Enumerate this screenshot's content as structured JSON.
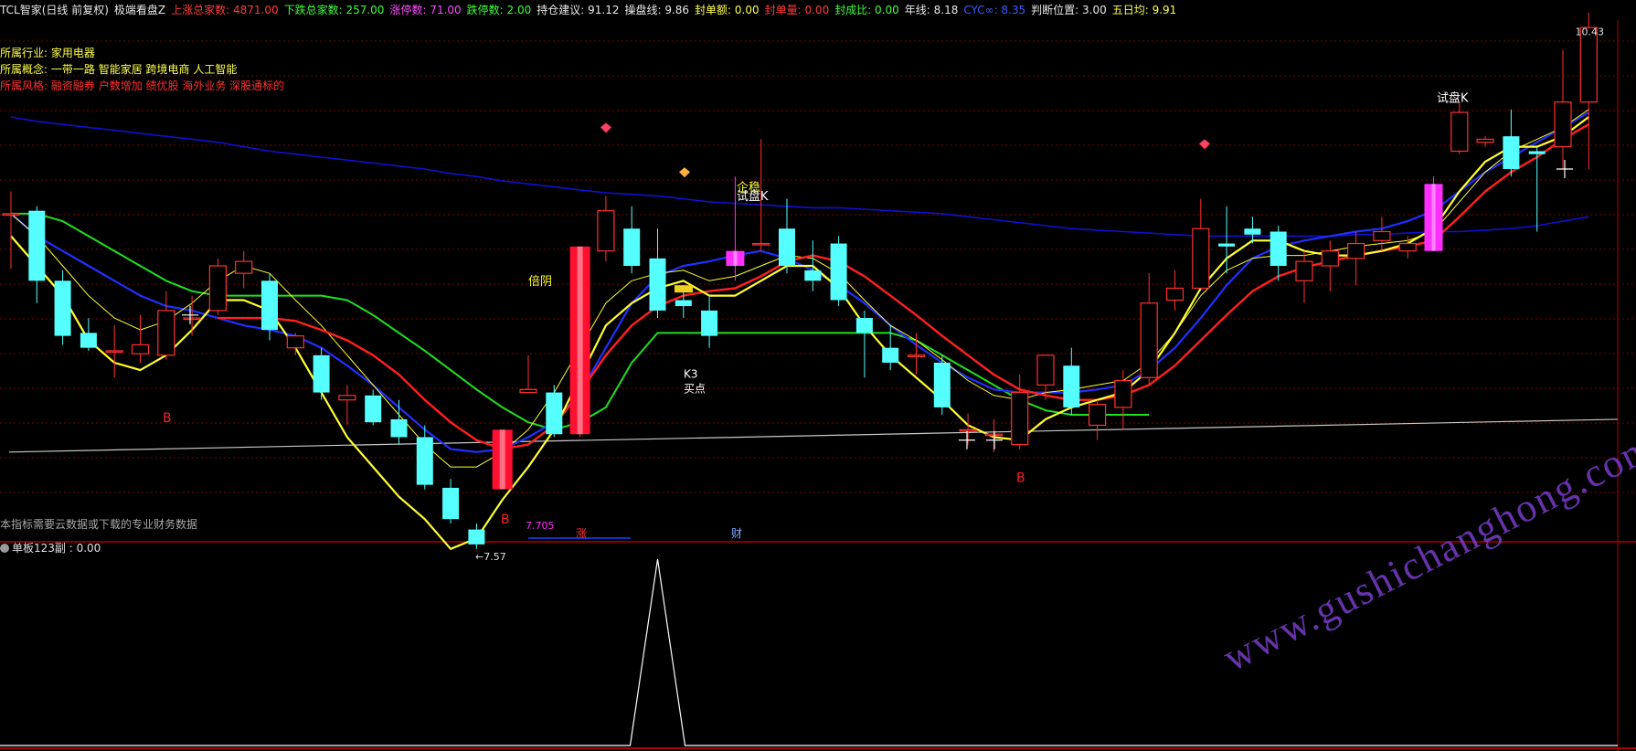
{
  "header": {
    "items": [
      {
        "label": "TCL智家(日线 前复权)",
        "color": "#e8e8e8"
      },
      {
        "label": "极端看盘Z",
        "color": "#e8e8e8"
      },
      {
        "label": "上涨总家数: 4871.00",
        "color": "#ff3b3b"
      },
      {
        "label": "下跌总家数: 257.00",
        "color": "#3cff3c"
      },
      {
        "label": "涨停数: 71.00",
        "color": "#ff4dff"
      },
      {
        "label": "跌停数: 2.00",
        "color": "#3cff3c"
      },
      {
        "label": "持仓建议: 91.12",
        "color": "#e8e8e8"
      },
      {
        "label": "操盘线: 9.86",
        "color": "#e8e8e8"
      },
      {
        "label": "封单额: 0.00",
        "color": "#ffff4d"
      },
      {
        "label": "封单量: 0.00",
        "color": "#ff3b3b"
      },
      {
        "label": "封成比: 0.00",
        "color": "#3cff3c"
      },
      {
        "label": "年线: 8.18",
        "color": "#e8e8e8"
      },
      {
        "label": "CYC∞: 8.35",
        "color": "#3c5cff"
      },
      {
        "label": "判断位置: 3.00",
        "color": "#e8e8e8"
      },
      {
        "label": "五日均: 9.91",
        "color": "#ffff4d"
      }
    ]
  },
  "info": {
    "industry_label": "所属行业:",
    "industry_value": "家用电器",
    "concept_label": "所属概念:",
    "concept_value": "一带一路 智能家居 跨境电商 人工智能",
    "style_label": "所属风格:",
    "style_value": "融资融券 户数增加 绩优股 海外业务 深股通标的"
  },
  "note": "本指标需要云数据或下载的专业财务数据",
  "sub_panel": {
    "title": "单板123副 : 0.00"
  },
  "watermark": "www.gushichanghong.com",
  "colors": {
    "up": "#ff3030",
    "down": "#55ffff",
    "ma_yellow": "#ffff30",
    "ma_red": "#ff2020",
    "ma_blue": "#2030ff",
    "ma_green": "#20e020",
    "cyc_blue": "#1010d0",
    "year_line": "#c8c8c8",
    "magenta": "#ff30ff",
    "grid": "#800000"
  },
  "chart_data": {
    "type": "candlestick",
    "price_range": [
      7.3,
      10.6
    ],
    "candles": [
      {
        "o": 9.3,
        "h": 9.45,
        "l": 8.93,
        "c": 9.3
      },
      {
        "o": 9.32,
        "h": 9.35,
        "l": 8.7,
        "c": 8.85
      },
      {
        "o": 8.85,
        "h": 8.92,
        "l": 8.42,
        "c": 8.48
      },
      {
        "o": 8.5,
        "h": 8.6,
        "l": 8.38,
        "c": 8.4
      },
      {
        "o": 8.38,
        "h": 8.55,
        "l": 8.2,
        "c": 8.38
      },
      {
        "o": 8.36,
        "h": 8.62,
        "l": 8.3,
        "c": 8.42
      },
      {
        "o": 8.35,
        "h": 8.78,
        "l": 8.32,
        "c": 8.65
      },
      {
        "o": 8.6,
        "h": 8.75,
        "l": 8.48,
        "c": 8.6
      },
      {
        "o": 8.65,
        "h": 9.0,
        "l": 8.62,
        "c": 8.95
      },
      {
        "o": 8.9,
        "h": 9.05,
        "l": 8.8,
        "c": 8.98
      },
      {
        "o": 8.85,
        "h": 8.9,
        "l": 8.45,
        "c": 8.52
      },
      {
        "o": 8.4,
        "h": 8.5,
        "l": 8.35,
        "c": 8.48
      },
      {
        "o": 8.35,
        "h": 8.4,
        "l": 8.05,
        "c": 8.1
      },
      {
        "o": 8.05,
        "h": 8.15,
        "l": 7.88,
        "c": 8.08
      },
      {
        "o": 8.08,
        "h": 8.12,
        "l": 7.88,
        "c": 7.9
      },
      {
        "o": 7.92,
        "h": 8.05,
        "l": 7.75,
        "c": 7.8
      },
      {
        "o": 7.8,
        "h": 7.88,
        "l": 7.45,
        "c": 7.48
      },
      {
        "o": 7.46,
        "h": 7.52,
        "l": 7.22,
        "c": 7.25
      },
      {
        "o": 7.18,
        "h": 7.22,
        "l": 7.05,
        "c": 7.08
      },
      {
        "o": 7.45,
        "h": 7.85,
        "l": 7.45,
        "c": 7.85
      },
      {
        "o": 8.1,
        "h": 8.35,
        "l": 8.1,
        "c": 8.12
      },
      {
        "o": 8.1,
        "h": 8.15,
        "l": 7.8,
        "c": 7.82
      },
      {
        "o": 7.82,
        "h": 9.08,
        "l": 7.8,
        "c": 9.08
      },
      {
        "o": 9.05,
        "h": 9.42,
        "l": 8.98,
        "c": 9.32
      },
      {
        "o": 9.2,
        "h": 9.35,
        "l": 8.9,
        "c": 8.95
      },
      {
        "o": 9.0,
        "h": 9.2,
        "l": 8.6,
        "c": 8.65
      },
      {
        "o": 8.72,
        "h": 8.82,
        "l": 8.6,
        "c": 8.68
      },
      {
        "o": 8.65,
        "h": 8.75,
        "l": 8.4,
        "c": 8.48
      },
      {
        "o": 9.05,
        "h": 9.55,
        "l": 8.85,
        "c": 8.95
      },
      {
        "o": 9.1,
        "h": 9.8,
        "l": 9.05,
        "c": 9.1
      },
      {
        "o": 9.2,
        "h": 9.4,
        "l": 8.9,
        "c": 8.95
      },
      {
        "o": 8.92,
        "h": 9.12,
        "l": 8.78,
        "c": 8.85
      },
      {
        "o": 9.1,
        "h": 9.15,
        "l": 8.68,
        "c": 8.72
      },
      {
        "o": 8.6,
        "h": 8.65,
        "l": 8.2,
        "c": 8.5
      },
      {
        "o": 8.4,
        "h": 8.55,
        "l": 8.25,
        "c": 8.3
      },
      {
        "o": 8.35,
        "h": 8.5,
        "l": 8.22,
        "c": 8.35
      },
      {
        "o": 8.3,
        "h": 8.35,
        "l": 7.95,
        "c": 8.0
      },
      {
        "o": 7.85,
        "h": 7.96,
        "l": 7.75,
        "c": 7.85
      },
      {
        "o": 7.82,
        "h": 7.92,
        "l": 7.7,
        "c": 7.82
      },
      {
        "o": 7.75,
        "h": 8.22,
        "l": 7.72,
        "c": 8.1
      },
      {
        "o": 8.15,
        "h": 8.35,
        "l": 8.05,
        "c": 8.35
      },
      {
        "o": 8.28,
        "h": 8.4,
        "l": 7.95,
        "c": 8.0
      },
      {
        "o": 7.88,
        "h": 8.05,
        "l": 7.78,
        "c": 8.02
      },
      {
        "o": 8.0,
        "h": 8.25,
        "l": 7.85,
        "c": 8.18
      },
      {
        "o": 8.2,
        "h": 8.9,
        "l": 8.15,
        "c": 8.7
      },
      {
        "o": 8.72,
        "h": 8.92,
        "l": 8.65,
        "c": 8.8
      },
      {
        "o": 8.8,
        "h": 9.4,
        "l": 8.8,
        "c": 9.2
      },
      {
        "o": 9.1,
        "h": 9.35,
        "l": 8.9,
        "c": 9.08
      },
      {
        "o": 9.2,
        "h": 9.28,
        "l": 9.1,
        "c": 9.16
      },
      {
        "o": 9.18,
        "h": 9.22,
        "l": 8.85,
        "c": 8.95
      },
      {
        "o": 8.85,
        "h": 9.05,
        "l": 8.7,
        "c": 8.98
      },
      {
        "o": 8.95,
        "h": 9.12,
        "l": 8.78,
        "c": 9.05
      },
      {
        "o": 9.0,
        "h": 9.18,
        "l": 8.82,
        "c": 9.1
      },
      {
        "o": 9.12,
        "h": 9.28,
        "l": 9.05,
        "c": 9.18
      },
      {
        "o": 9.05,
        "h": 9.15,
        "l": 9.0,
        "c": 9.1
      },
      {
        "o": 9.5,
        "h": 9.55,
        "l": 9.05,
        "c": 9.05
      },
      {
        "o": 9.72,
        "h": 10.05,
        "l": 9.7,
        "c": 9.98
      },
      {
        "o": 9.78,
        "h": 9.82,
        "l": 9.75,
        "c": 9.8
      },
      {
        "o": 9.82,
        "h": 10.0,
        "l": 9.55,
        "c": 9.6
      },
      {
        "o": 9.72,
        "h": 9.75,
        "l": 9.18,
        "c": 9.7
      },
      {
        "o": 9.75,
        "h": 10.4,
        "l": 9.6,
        "c": 10.05
      },
      {
        "o": 10.05,
        "h": 10.65,
        "l": 9.6,
        "c": 10.55
      }
    ],
    "line_yellow": [
      9.15,
      8.95,
      8.75,
      8.45,
      8.3,
      8.25,
      8.35,
      8.52,
      8.72,
      8.72,
      8.65,
      8.4,
      8.1,
      7.8,
      7.6,
      7.4,
      7.25,
      7.05,
      7.12,
      7.38,
      7.6,
      7.85,
      8.2,
      8.55,
      8.7,
      8.8,
      8.85,
      8.75,
      8.75,
      8.85,
      8.95,
      8.95,
      8.8,
      8.55,
      8.35,
      8.2,
      8.05,
      7.88,
      7.8,
      7.78,
      7.92,
      8.0,
      8.05,
      8.1,
      8.25,
      8.5,
      8.8,
      9.0,
      9.12,
      9.12,
      9.05,
      9.02,
      9.02,
      9.05,
      9.1,
      9.2,
      9.45,
      9.65,
      9.75,
      9.75,
      9.82,
      9.95
    ],
    "line_thin_yellow": [
      9.3,
      9.15,
      8.95,
      8.75,
      8.6,
      8.52,
      8.58,
      8.7,
      8.85,
      8.95,
      8.9,
      8.72,
      8.55,
      8.35,
      8.15,
      7.95,
      7.75,
      7.6,
      7.6,
      7.7,
      7.85,
      8.1,
      8.4,
      8.7,
      8.85,
      8.9,
      8.92,
      8.85,
      8.88,
      8.95,
      9.02,
      9.0,
      8.9,
      8.72,
      8.55,
      8.45,
      8.32,
      8.18,
      8.08,
      8.05,
      8.1,
      8.12,
      8.15,
      8.18,
      8.3,
      8.5,
      8.75,
      8.92,
      9.0,
      9.02,
      9.02,
      9.05,
      9.08,
      9.1,
      9.12,
      9.18,
      9.38,
      9.58,
      9.72,
      9.8,
      9.88,
      10.0
    ],
    "line_red": [
      null,
      null,
      null,
      null,
      null,
      null,
      null,
      null,
      8.6,
      8.6,
      8.6,
      8.58,
      8.52,
      8.45,
      8.35,
      8.22,
      8.05,
      7.9,
      7.78,
      7.72,
      7.75,
      7.88,
      8.1,
      8.35,
      8.55,
      8.68,
      8.75,
      8.78,
      8.8,
      8.88,
      8.98,
      9.02,
      8.98,
      8.88,
      8.75,
      8.62,
      8.48,
      8.35,
      8.22,
      8.12,
      8.08,
      8.05,
      8.05,
      8.08,
      8.15,
      8.28,
      8.45,
      8.62,
      8.78,
      8.88,
      8.94,
      8.98,
      9.02,
      9.05,
      9.08,
      9.12,
      9.28,
      9.45,
      9.58,
      9.68,
      9.8,
      9.9
    ],
    "line_blue": [
      9.3,
      9.15,
      9.05,
      8.95,
      8.85,
      8.75,
      8.68,
      8.65,
      8.6,
      8.55,
      8.52,
      8.48,
      8.4,
      8.28,
      8.15,
      8.0,
      7.85,
      7.72,
      7.7,
      7.72,
      7.8,
      7.9,
      8.1,
      8.4,
      8.7,
      8.88,
      8.95,
      8.98,
      9.02,
      9.05,
      9.0,
      8.92,
      8.82,
      8.7,
      8.55,
      8.42,
      8.3,
      8.2,
      8.12,
      8.1,
      8.1,
      8.1,
      8.12,
      8.15,
      8.25,
      8.4,
      8.6,
      8.82,
      9.0,
      9.08,
      9.12,
      9.15,
      9.18,
      9.2,
      9.25,
      9.32,
      9.45,
      9.58,
      9.68,
      9.78,
      9.88,
      9.98
    ],
    "line_green": [
      9.3,
      9.3,
      9.25,
      9.15,
      9.05,
      8.95,
      8.85,
      8.78,
      8.75,
      8.75,
      8.75,
      8.75,
      8.75,
      8.72,
      8.62,
      8.5,
      8.38,
      8.25,
      8.12,
      8.0,
      7.9,
      7.85,
      7.9,
      8.0,
      8.3,
      8.5,
      8.5,
      8.5,
      8.5,
      8.5,
      8.5,
      8.5,
      8.5,
      8.5,
      8.5,
      8.45,
      8.35,
      8.25,
      8.15,
      8.05,
      7.98,
      7.95,
      7.95,
      7.95,
      7.95
    ],
    "cyc_blue": [
      9.95,
      9.92,
      9.9,
      9.88,
      9.86,
      9.84,
      9.82,
      9.8,
      9.78,
      9.75,
      9.72,
      9.7,
      9.68,
      9.66,
      9.64,
      9.62,
      9.6,
      9.57,
      9.55,
      9.52,
      9.5,
      9.48,
      9.46,
      9.44,
      9.43,
      9.42,
      9.4,
      9.38,
      9.37,
      9.36,
      9.35,
      9.34,
      9.34,
      9.33,
      9.32,
      9.31,
      9.3,
      9.28,
      9.26,
      9.24,
      9.22,
      9.2,
      9.19,
      9.18,
      9.17,
      9.16,
      9.15,
      9.15,
      9.15,
      9.15,
      9.15,
      9.15,
      9.16,
      9.16,
      9.17,
      9.18,
      9.18,
      9.19,
      9.2,
      9.22,
      9.25,
      9.28
    ],
    "year_line": {
      "start": 7.7,
      "end": 7.92
    },
    "sub_series_peak_index": 26,
    "annotations": [
      {
        "text": "10.43",
        "kind": "price_label"
      },
      {
        "text": "←7.57",
        "kind": "price_label"
      },
      {
        "text": "7.705",
        "kind": "price_label"
      },
      {
        "text": "倍阴",
        "kind": "signal"
      },
      {
        "text": "企稳",
        "kind": "signal"
      },
      {
        "text": "试盘K",
        "kind": "signal"
      },
      {
        "text": "K3",
        "kind": "signal"
      },
      {
        "text": "买点",
        "kind": "signal"
      },
      {
        "text": "试盘K",
        "kind": "signal"
      },
      {
        "text": "B",
        "kind": "signal"
      },
      {
        "text": "B",
        "kind": "signal"
      },
      {
        "text": "B",
        "kind": "signal"
      },
      {
        "text": "涨",
        "kind": "marker"
      },
      {
        "text": "财",
        "kind": "marker"
      }
    ]
  }
}
